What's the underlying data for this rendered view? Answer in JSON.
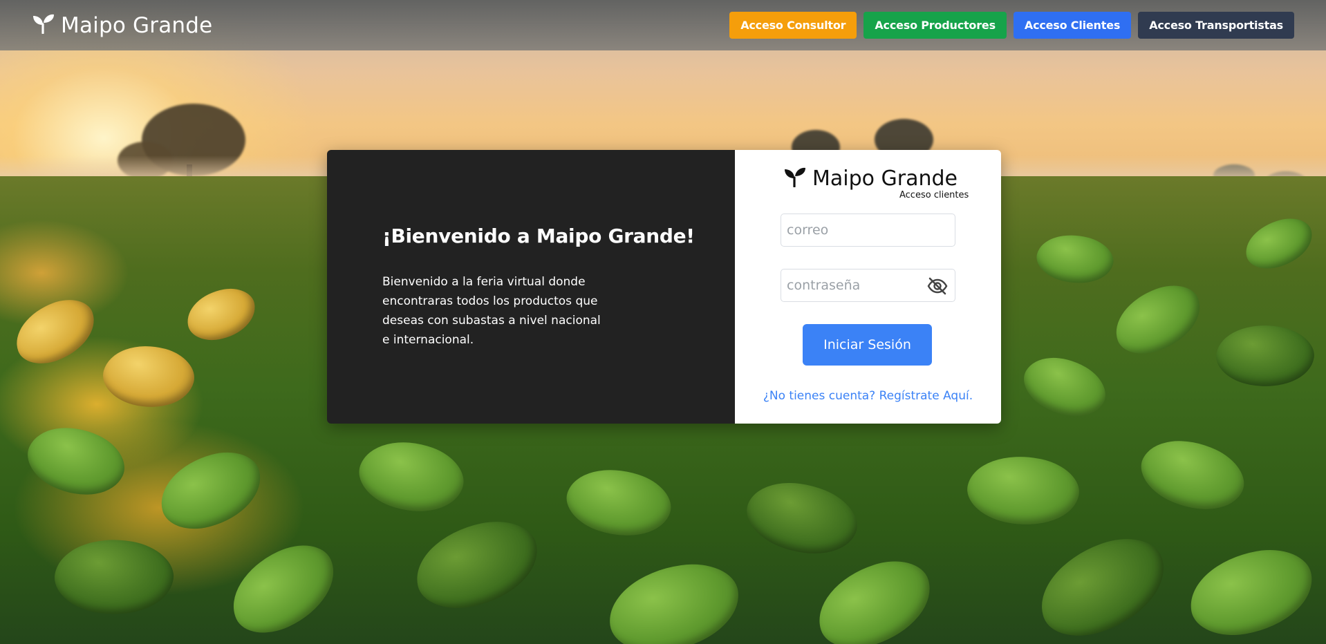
{
  "navbar": {
    "brand": "Maipo Grande",
    "buttons": {
      "consultor": "Acceso Consultor",
      "productores": "Acceso Productores",
      "clientes": "Acceso Clientes",
      "transportistas": "Acceso Transportistas"
    }
  },
  "welcome": {
    "title": "¡Bienvenido a Maipo Grande!",
    "text": "Bienvenido a la feria virtual donde encontraras todos los productos que deseas con subastas a nivel nacional e internacional."
  },
  "login": {
    "brand": "Maipo Grande",
    "subtitle": "Acceso clientes",
    "email_placeholder": "correo",
    "password_placeholder": "contraseña",
    "submit_label": "Iniciar Sesión",
    "register_link": "¿No tienes cuenta? Regístrate Aquí."
  },
  "icons": {
    "brand": "seedling-icon",
    "password_toggle": "eye-slash-icon"
  },
  "colors": {
    "consultor": "#f59e0b",
    "productores": "#16a34a",
    "clientes": "#2f6ff2",
    "transportistas": "#303b50",
    "card_dark": "#222222",
    "primary": "#3b82f6"
  }
}
